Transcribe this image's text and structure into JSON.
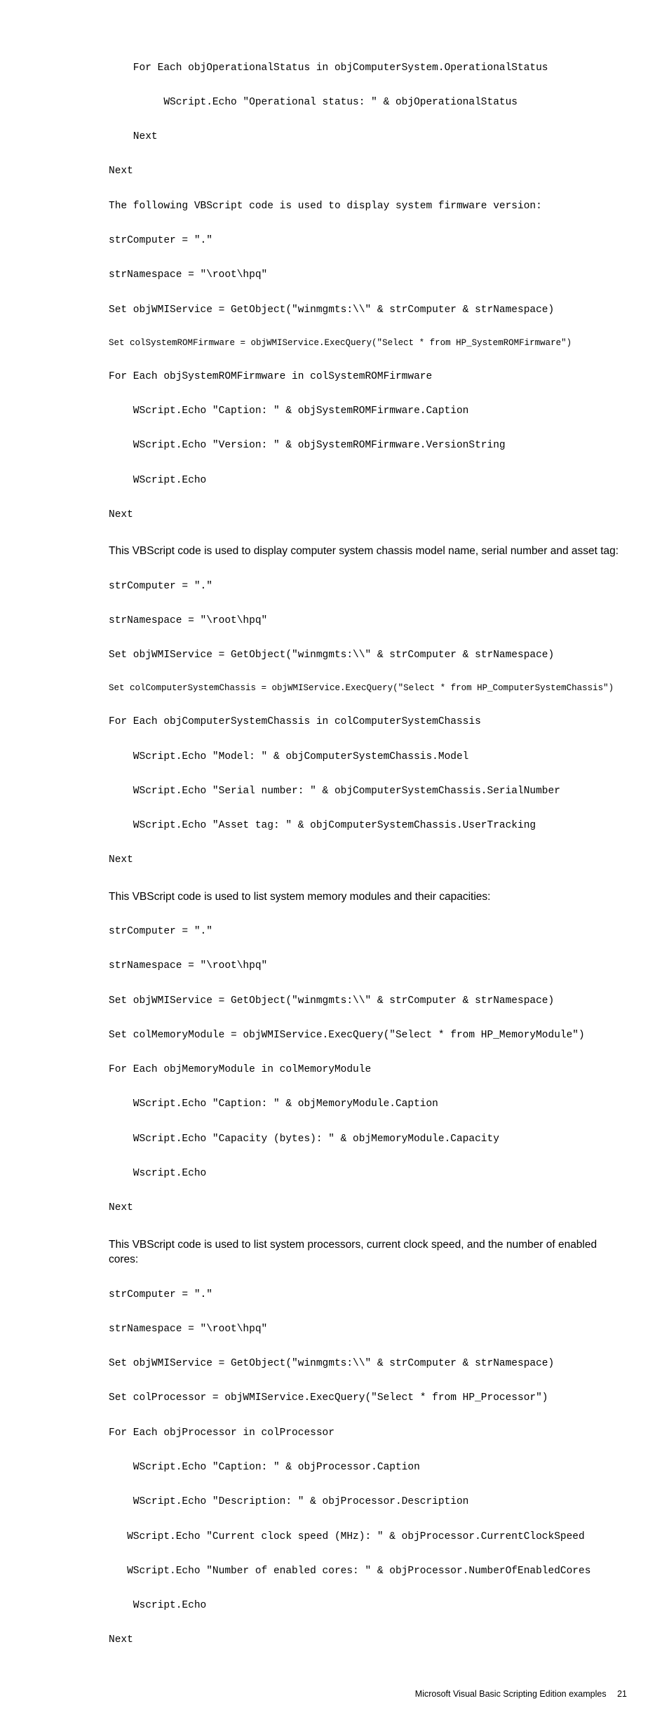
{
  "block1": {
    "l1": "    For Each objOperationalStatus in objComputerSystem.OperationalStatus",
    "l2": "         WScript.Echo \"Operational status: \" & objOperationalStatus",
    "l3": "    Next",
    "l4": "Next",
    "l5": "The following VBScript code is used to display system firmware version:",
    "l6": "strComputer = \".\"",
    "l7": "strNamespace = \"\\root\\hpq\"",
    "l8": "Set objWMIService = GetObject(\"winmgmts:\\\\\" & strComputer & strNamespace)",
    "l9": "Set colSystemROMFirmware = objWMIService.ExecQuery(\"Select * from HP_SystemROMFirmware\")",
    "l10": "For Each objSystemROMFirmware in colSystemROMFirmware",
    "l11": "    WScript.Echo \"Caption: \" & objSystemROMFirmware.Caption",
    "l12": "    WScript.Echo \"Version: \" & objSystemROMFirmware.VersionString",
    "l13": "    WScript.Echo",
    "l14": "Next"
  },
  "para1": "This VBScript code is used to display computer system chassis model name, serial number and asset tag:",
  "block2": {
    "l1": "strComputer = \".\"",
    "l2": "strNamespace = \"\\root\\hpq\"",
    "l3": "Set objWMIService = GetObject(\"winmgmts:\\\\\" & strComputer & strNamespace)",
    "l4": "Set colComputerSystemChassis = objWMIService.ExecQuery(\"Select * from HP_ComputerSystemChassis\")",
    "l5": "For Each objComputerSystemChassis in colComputerSystemChassis",
    "l6": "    WScript.Echo \"Model: \" & objComputerSystemChassis.Model",
    "l7": "    WScript.Echo \"Serial number: \" & objComputerSystemChassis.SerialNumber",
    "l8": "    WScript.Echo \"Asset tag: \" & objComputerSystemChassis.UserTracking",
    "l9": "Next"
  },
  "para2": "This VBScript code is used to list system memory modules and their capacities:",
  "block3": {
    "l1": "strComputer = \".\"",
    "l2": "strNamespace = \"\\root\\hpq\"",
    "l3": "Set objWMIService = GetObject(\"winmgmts:\\\\\" & strComputer & strNamespace)",
    "l4": "Set colMemoryModule = objWMIService.ExecQuery(\"Select * from HP_MemoryModule\")",
    "l5": "For Each objMemoryModule in colMemoryModule",
    "l6": "    WScript.Echo \"Caption: \" & objMemoryModule.Caption",
    "l7": "    WScript.Echo \"Capacity (bytes): \" & objMemoryModule.Capacity",
    "l8": "    Wscript.Echo",
    "l9": "Next"
  },
  "para3": "This VBScript code is used to list system processors, current clock speed, and the number of enabled cores:",
  "block4": {
    "l1": "strComputer = \".\"",
    "l2": "strNamespace = \"\\root\\hpq\"",
    "l3": "Set objWMIService = GetObject(\"winmgmts:\\\\\" & strComputer & strNamespace)",
    "l4": "Set colProcessor = objWMIService.ExecQuery(\"Select * from HP_Processor\")",
    "l5": "For Each objProcessor in colProcessor",
    "l6": "    WScript.Echo \"Caption: \" & objProcessor.Caption",
    "l7": "    WScript.Echo \"Description: \" & objProcessor.Description",
    "l8": "   WScript.Echo \"Current clock speed (MHz): \" & objProcessor.CurrentClockSpeed",
    "l9": "   WScript.Echo \"Number of enabled cores: \" & objProcessor.NumberOfEnabledCores",
    "l10": "    Wscript.Echo",
    "l11": "Next"
  },
  "footer": {
    "title": "Microsoft Visual Basic Scripting Edition examples",
    "page": "21"
  }
}
